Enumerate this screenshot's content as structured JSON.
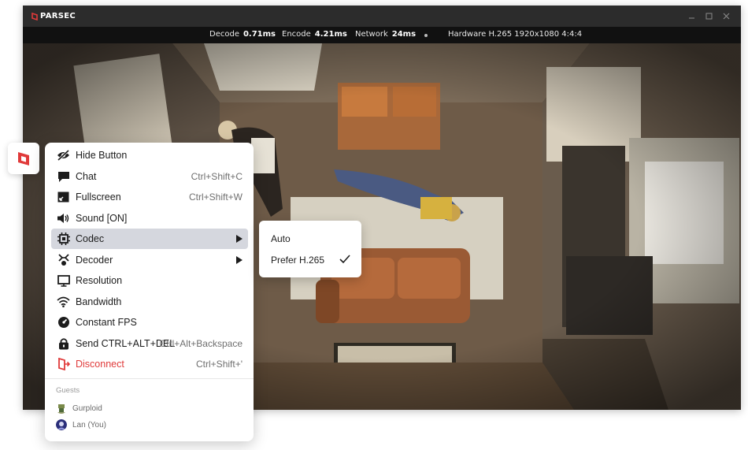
{
  "app": {
    "name": "PARSEC"
  },
  "window_controls": [
    {
      "name": "minimize",
      "icon": "minimize-icon"
    },
    {
      "name": "maximize",
      "icon": "maximize-icon"
    },
    {
      "name": "close",
      "icon": "close-icon"
    }
  ],
  "stats": {
    "decode_label": "Decode",
    "decode_value": "0.71ms",
    "encode_label": "Encode",
    "encode_value": "4.21ms",
    "network_label": "Network",
    "network_value": "24ms",
    "hardware": "Hardware H.265 1920x1080 4:4:4"
  },
  "menu": {
    "items": [
      {
        "label": "Hide Button",
        "shortcut": "",
        "icon": "eye-off-icon"
      },
      {
        "label": "Chat",
        "shortcut": "Ctrl+Shift+C",
        "icon": "chat-icon"
      },
      {
        "label": "Fullscreen",
        "shortcut": "Ctrl+Shift+W",
        "icon": "fullscreen-icon"
      },
      {
        "label": "Sound [ON]",
        "shortcut": "",
        "icon": "speaker-icon"
      },
      {
        "label": "Codec",
        "shortcut": "",
        "icon": "chip-icon",
        "submenu": true,
        "highlighted": true
      },
      {
        "label": "Decoder",
        "shortcut": "",
        "icon": "decoder-icon",
        "submenu": true
      },
      {
        "label": "Resolution",
        "shortcut": "",
        "icon": "monitor-icon"
      },
      {
        "label": "Bandwidth",
        "shortcut": "",
        "icon": "wifi-icon"
      },
      {
        "label": "Constant FPS",
        "shortcut": "",
        "icon": "gauge-icon"
      },
      {
        "label": "Send CTRL+ALT+DEL",
        "shortcut": "Ctrl+Alt+Backspace",
        "icon": "lock-icon"
      },
      {
        "label": "Disconnect",
        "shortcut": "Ctrl+Shift+'",
        "icon": "disconnect-icon",
        "danger": true
      }
    ],
    "guests_heading": "Guests",
    "guests": [
      {
        "name": "Gurploid",
        "icon": "avatar-icon"
      },
      {
        "name": "Lan (You)",
        "icon": "avatar-icon"
      }
    ]
  },
  "codec_submenu": {
    "items": [
      {
        "label": "Auto",
        "checked": false
      },
      {
        "label": "Prefer H.265",
        "checked": true
      }
    ]
  },
  "colors": {
    "accent_red": "#e03a3a",
    "highlight": "#d5d7de",
    "titlebar": "#2c2c2c"
  }
}
